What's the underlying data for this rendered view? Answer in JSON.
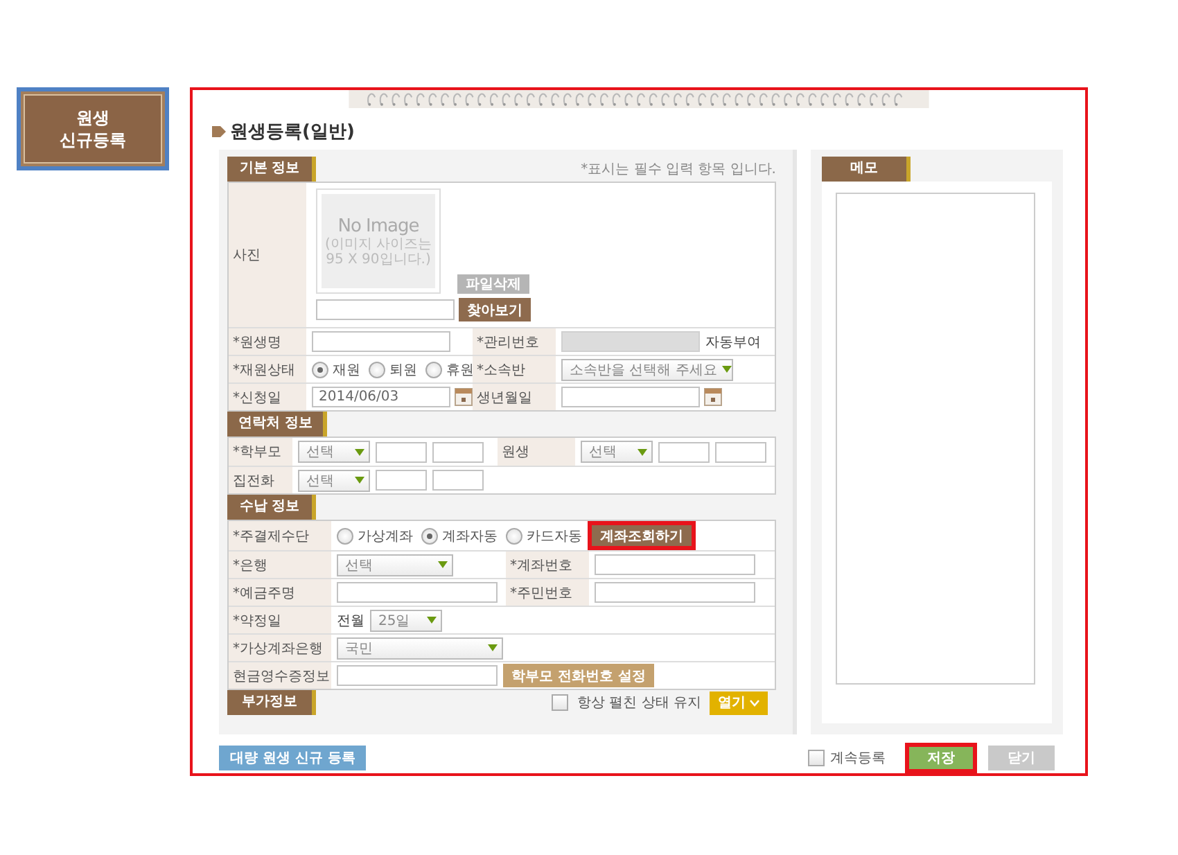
{
  "side_button": {
    "lines": [
      "원생",
      "신규등록"
    ]
  },
  "window": {
    "title": "원생등록(일반)",
    "highlighted": true
  },
  "sections": [
    {
      "kind": "basic",
      "heading": "기본 정보",
      "note": "*표시는 필수 입력 항목 입니다.",
      "rows": [
        {
          "cells": [
            {
              "kind": "label",
              "text": "사진"
            },
            {
              "kind": "photo",
              "placeholder_title": "No Image",
              "placeholder_note": "(이미지 사이즈는 95 X 90입니다.)",
              "delete_button": "파일삭제",
              "browse_button": "찾아보기"
            }
          ]
        },
        {
          "cells": [
            {
              "kind": "label",
              "text": "*원생명"
            },
            {
              "kind": "input",
              "disabled": false
            },
            {
              "kind": "label",
              "text": "*관리번호"
            },
            {
              "kind": "input",
              "disabled": true
            },
            {
              "kind": "text",
              "text": "자동부여"
            }
          ]
        },
        {
          "cells": [
            {
              "kind": "label",
              "text": "*재원상태"
            },
            {
              "kind": "radios",
              "options": [
                {
                  "label": "재원",
                  "selected": true
                },
                {
                  "label": "퇴원",
                  "selected": false
                },
                {
                  "label": "휴원",
                  "selected": false
                }
              ]
            },
            {
              "kind": "label",
              "text": "*소속반"
            },
            {
              "kind": "select",
              "value": "소속반을 선택해 주세요"
            }
          ]
        },
        {
          "cells": [
            {
              "kind": "label",
              "text": "*신청일"
            },
            {
              "kind": "date",
              "value": "2014/06/03"
            },
            {
              "kind": "label",
              "text": "생년월일"
            },
            {
              "kind": "date"
            }
          ]
        }
      ]
    },
    {
      "kind": "contact",
      "heading": "연락처 정보",
      "rows": [
        {
          "cells": [
            {
              "kind": "label",
              "text": "*학부모"
            },
            {
              "kind": "select",
              "value": "선택"
            },
            {
              "kind": "input",
              "disabled": false
            },
            {
              "kind": "input",
              "disabled": false
            },
            {
              "kind": "label",
              "text": "원생"
            },
            {
              "kind": "select",
              "value": "선택"
            },
            {
              "kind": "input",
              "disabled": false
            },
            {
              "kind": "input",
              "disabled": false
            }
          ]
        },
        {
          "cells": [
            {
              "kind": "label",
              "text": "집전화"
            },
            {
              "kind": "select",
              "value": "선택"
            },
            {
              "kind": "input",
              "disabled": false
            },
            {
              "kind": "input",
              "disabled": false
            }
          ]
        }
      ]
    },
    {
      "kind": "payment",
      "heading": "수납 정보",
      "rows": [
        {
          "cells": [
            {
              "kind": "label",
              "text": "*주결제수단"
            },
            {
              "kind": "radios",
              "options": [
                {
                  "label": "가상계좌",
                  "selected": false
                },
                {
                  "label": "계좌자동",
                  "selected": true
                },
                {
                  "label": "카드자동",
                  "selected": false
                }
              ]
            },
            {
              "kind": "button",
              "label": "계좌조회하기",
              "highlighted": true
            }
          ]
        },
        {
          "cells": [
            {
              "kind": "label",
              "text": "*은행"
            },
            {
              "kind": "select",
              "value": "선택"
            },
            {
              "kind": "label",
              "text": "*계좌번호"
            },
            {
              "kind": "input",
              "disabled": false
            }
          ]
        },
        {
          "cells": [
            {
              "kind": "label",
              "text": "*예금주명"
            },
            {
              "kind": "input",
              "disabled": false
            },
            {
              "kind": "label",
              "text": "*주민번호"
            },
            {
              "kind": "input",
              "disabled": false
            }
          ]
        },
        {
          "cells": [
            {
              "kind": "label",
              "text": "*약정일"
            },
            {
              "kind": "text",
              "text": "전월"
            },
            {
              "kind": "select",
              "value": "25일"
            }
          ]
        },
        {
          "cells": [
            {
              "kind": "label",
              "text": "*가상계좌은행"
            },
            {
              "kind": "select",
              "value": "국민"
            }
          ]
        },
        {
          "cells": [
            {
              "kind": "label",
              "text": "현금영수증정보"
            },
            {
              "kind": "input",
              "disabled": false
            },
            {
              "kind": "button",
              "label": "학부모 전화번호 설정",
              "highlighted": false
            }
          ]
        }
      ]
    },
    {
      "kind": "extra",
      "heading": "부가정보",
      "toggle": {
        "label": "항상 펼친 상태 유지",
        "checked": false,
        "button": "열기"
      }
    }
  ],
  "memo": {
    "heading": "메모"
  },
  "footer": {
    "bulk_button": "대량 원생 신규 등록",
    "continue": {
      "label": "계속등록",
      "checked": false
    },
    "buttons": [
      {
        "label": "저장",
        "kind": "save",
        "highlighted": true
      },
      {
        "label": "닫기",
        "kind": "close",
        "highlighted": false
      }
    ]
  }
}
